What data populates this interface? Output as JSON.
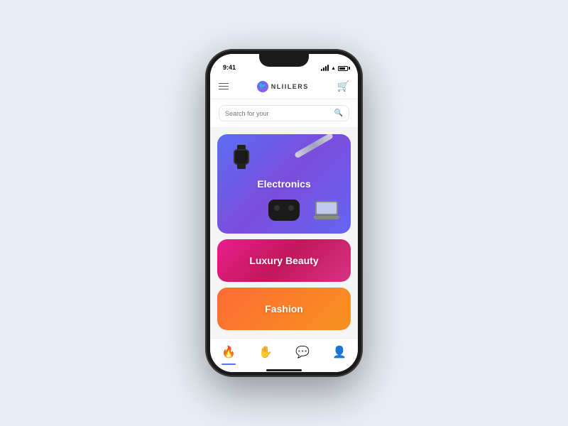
{
  "app": {
    "name": "NLIILERS",
    "status_time": "9:41"
  },
  "navbar": {
    "cart_label": "cart",
    "menu_label": "menu"
  },
  "search": {
    "placeholder": "Search for your"
  },
  "categories": [
    {
      "id": "electronics",
      "label": "Electronics",
      "gradient_start": "#5b6ef5",
      "gradient_end": "#7c4ddb"
    },
    {
      "id": "luxury-beauty",
      "label": "Luxury Beauty",
      "gradient_start": "#e91e8c",
      "gradient_end": "#c2185b"
    },
    {
      "id": "fashion",
      "label": "Fashion",
      "gradient_start": "#ff6b35",
      "gradient_end": "#f7931e"
    }
  ],
  "bottom_nav": [
    {
      "id": "home",
      "icon": "🔥",
      "active": true
    },
    {
      "id": "gesture",
      "icon": "👋",
      "active": false
    },
    {
      "id": "chat",
      "icon": "💬",
      "active": false
    },
    {
      "id": "profile",
      "icon": "👤",
      "active": false
    }
  ]
}
